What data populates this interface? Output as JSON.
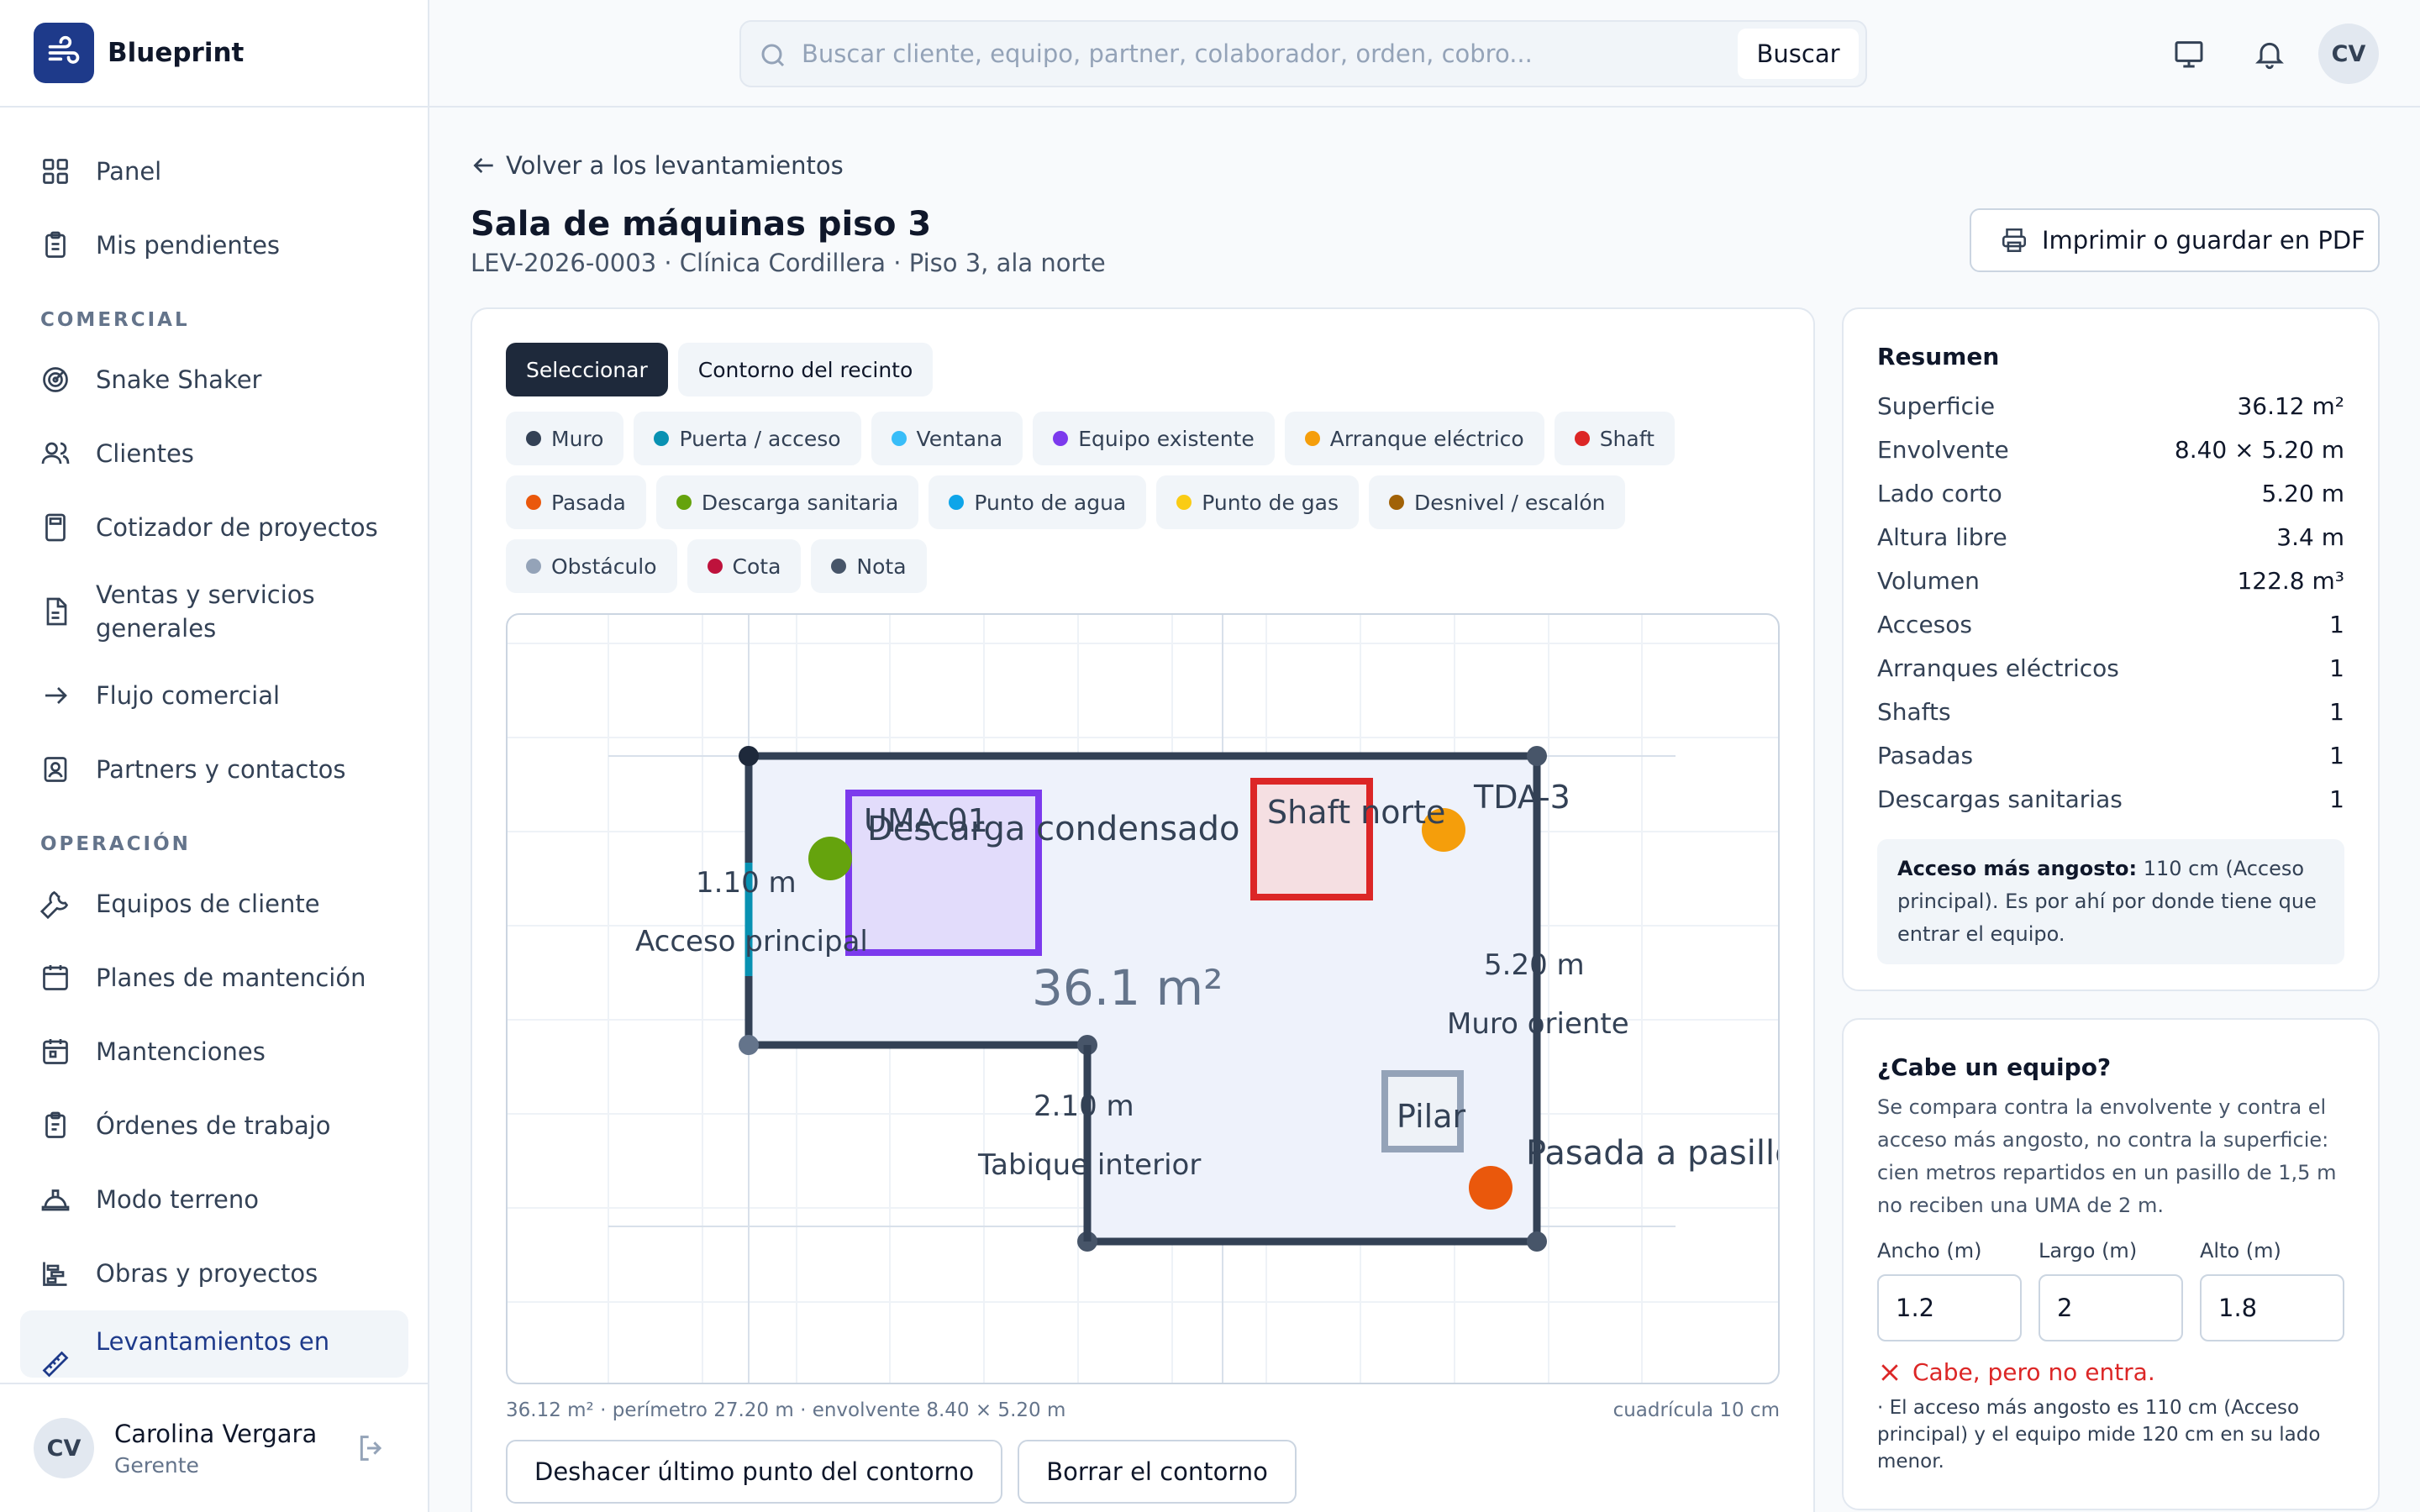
{
  "app": {
    "name": "Blueprint"
  },
  "search": {
    "placeholder": "Buscar cliente, equipo, partner, colaborador, orden, cobro...",
    "button": "Buscar"
  },
  "topbar": {
    "avatar_initials": "CV"
  },
  "sidebar": {
    "items": [
      {
        "label": "Panel"
      },
      {
        "label": "Mis pendientes"
      },
      {
        "section": "COMERCIAL"
      },
      {
        "label": "Snake Shaker"
      },
      {
        "label": "Clientes"
      },
      {
        "label": "Cotizador de proyectos"
      },
      {
        "label": "Ventas y servicios generales"
      },
      {
        "label": "Flujo comercial"
      },
      {
        "label": "Partners y contactos"
      },
      {
        "section": "OPERACIÓN"
      },
      {
        "label": "Equipos de cliente"
      },
      {
        "label": "Planes de mantención"
      },
      {
        "label": "Mantenciones"
      },
      {
        "label": "Órdenes de trabajo"
      },
      {
        "label": "Modo terreno"
      },
      {
        "label": "Obras y proyectos"
      },
      {
        "label": "Levantamientos en"
      }
    ]
  },
  "user": {
    "initials": "CV",
    "name": "Carolina Vergara",
    "role": "Gerente"
  },
  "page": {
    "back": "Volver a los levantamientos",
    "title": "Sala de máquinas piso 3",
    "subtitle": "LEV-2026-0003 · Clínica Cordillera · Piso 3, ala norte",
    "print": "Imprimir o guardar en PDF"
  },
  "editor": {
    "modes": [
      "Seleccionar",
      "Contorno del recinto"
    ],
    "tools": [
      {
        "label": "Muro",
        "color": "#334155"
      },
      {
        "label": "Puerta / acceso",
        "color": "#0891b2"
      },
      {
        "label": "Ventana",
        "color": "#38bdf8"
      },
      {
        "label": "Equipo existente",
        "color": "#7c3aed"
      },
      {
        "label": "Arranque eléctrico",
        "color": "#f59e0b"
      },
      {
        "label": "Shaft",
        "color": "#dc2626"
      },
      {
        "label": "Pasada",
        "color": "#ea580c"
      },
      {
        "label": "Descarga sanitaria",
        "color": "#65a30d"
      },
      {
        "label": "Punto de agua",
        "color": "#0ea5e9"
      },
      {
        "label": "Punto de gas",
        "color": "#facc15"
      },
      {
        "label": "Desnivel / escalón",
        "color": "#a16207"
      },
      {
        "label": "Obstáculo",
        "color": "#94a3b8"
      },
      {
        "label": "Cota",
        "color": "#be123c"
      },
      {
        "label": "Nota",
        "color": "#475569"
      }
    ],
    "plan": {
      "area_label": "36.1 m²",
      "dim_access": "1.10 m",
      "access_label": "Acceso principal",
      "equipment_label": "UMA-01",
      "drain_label": "Descarga condensado",
      "shaft_label": "Shaft norte",
      "panel_label": "TDA-3",
      "dim_east": "5.20 m",
      "east_wall_label": "Muro oriente",
      "pillar_label": "Pilar",
      "dim_partition": "2.10 m",
      "partition_label": "Tabique interior",
      "pass_label": "Pasada a pasillo"
    },
    "footer_left": "36.12 m² · perímetro 27.20 m · envolvente 8.40 × 5.20 m",
    "footer_right": "cuadrícula 10 cm",
    "undo": "Deshacer último punto del contorno",
    "clear": "Borrar el contorno"
  },
  "summary": {
    "title": "Resumen",
    "rows": [
      {
        "k": "Superficie",
        "v": "36.12 m²"
      },
      {
        "k": "Envolvente",
        "v": "8.40 × 5.20 m"
      },
      {
        "k": "Lado corto",
        "v": "5.20 m"
      },
      {
        "k": "Altura libre",
        "v": "3.4 m"
      },
      {
        "k": "Volumen",
        "v": "122.8 m³"
      },
      {
        "k": "Accesos",
        "v": "1"
      },
      {
        "k": "Arranques eléctricos",
        "v": "1"
      },
      {
        "k": "Shafts",
        "v": "1"
      },
      {
        "k": "Pasadas",
        "v": "1"
      },
      {
        "k": "Descargas sanitarias",
        "v": "1"
      }
    ],
    "note_bold": "Acceso más angosto:",
    "note_text": " 110 cm (Acceso principal). Es por ahí por donde tiene que entrar el equipo."
  },
  "fit": {
    "title": "¿Cabe un equipo?",
    "desc": "Se compara contra la envolvente y contra el acceso más angosto, no contra la superficie: cien metros repartidos en un pasillo de 1,5 m no reciben una UMA de 2 m.",
    "labels": [
      "Ancho (m)",
      "Largo (m)",
      "Alto (m)"
    ],
    "values": [
      "1.2",
      "2",
      "1.8"
    ],
    "result": "Cabe, pero no entra.",
    "detail": "· El acceso más angosto es 110 cm (Acceso principal) y el equipo mide 120 cm en su lado menor."
  }
}
